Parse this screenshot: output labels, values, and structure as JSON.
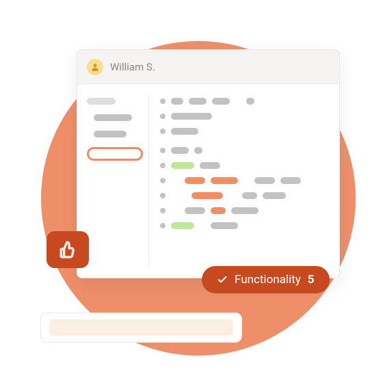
{
  "user": {
    "name": "William S."
  },
  "badge": {
    "label": "Functionality",
    "score": "5"
  },
  "colors": {
    "bg_circle": "#ef8f6a",
    "accent": "#c6491f",
    "orange_pill": "#ef8f66",
    "green_pill": "#bfe79a",
    "grey_pill": "#c2c2c2",
    "avatar_bg": "#f8df8d"
  },
  "icons": {
    "avatar": "user-avatar-icon",
    "like": "thumbs-up-icon",
    "check": "check-icon"
  }
}
